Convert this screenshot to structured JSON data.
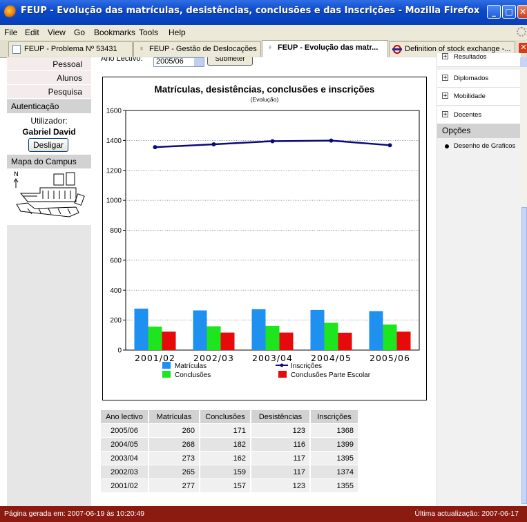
{
  "window": {
    "title": "FEUP - Evolução das matrículas, desistências, conclusões e das Inscrições - Mozilla Firefox"
  },
  "menu": {
    "file": "File",
    "edit": "Edit",
    "view": "View",
    "go": "Go",
    "bookmarks": "Bookmarks",
    "tools": "Tools",
    "help": "Help"
  },
  "tabs": [
    {
      "label": "FEUP - Problema Nº 53431",
      "icon": "page-icon"
    },
    {
      "label": "FEUP - Gestão de Deslocações",
      "icon": "feup-icon"
    },
    {
      "label": "FEUP - Evolução das matr...",
      "icon": "feup-icon"
    },
    {
      "label": "Definition of stock exchange -...",
      "icon": "tfl-roundel-icon"
    }
  ],
  "left_sidebar": {
    "nav": [
      "Pessoal",
      "Alunos",
      "Pesquisa"
    ],
    "auth_heading": "Autenticação",
    "user_label": "Utilizador:",
    "user_name": "Gabriel David",
    "logout": "Desligar",
    "map_heading": "Mapa do Campus",
    "map_north": "N"
  },
  "form": {
    "year_label": "Ano Lectivo:",
    "year_value": "2005/06",
    "submit": "Submeter"
  },
  "right_sidebar": {
    "items": [
      "Resultados",
      "Diplomados",
      "Mobilidade",
      "Docentes"
    ],
    "options_heading": "Opções",
    "charts_link": "Desenho de Graficos"
  },
  "chart_data": {
    "type": "bar",
    "title": "Matrículas, desistências, conclusões e inscrições",
    "subtitle": "(Evolução)",
    "categories": [
      "2001/02",
      "2002/03",
      "2003/04",
      "2004/05",
      "2005/06"
    ],
    "ylim": [
      0,
      1600
    ],
    "yticks": [
      0,
      200,
      400,
      600,
      800,
      1000,
      1200,
      1400,
      1600
    ],
    "grid": true,
    "series": [
      {
        "name": "Matrículas",
        "kind": "bar",
        "color": "#1e90f0",
        "values": [
          277,
          265,
          273,
          268,
          260
        ]
      },
      {
        "name": "Conclusões",
        "kind": "bar",
        "color": "#1ee61e",
        "values": [
          157,
          159,
          162,
          182,
          171
        ]
      },
      {
        "name": "Conclusões Parte Escolar",
        "kind": "bar",
        "color": "#e60a0a",
        "values": [
          123,
          117,
          117,
          116,
          123
        ]
      },
      {
        "name": "Inscrições",
        "kind": "line",
        "color": "#0a0a78",
        "values": [
          1355,
          1374,
          1395,
          1399,
          1368
        ]
      }
    ],
    "legend_position": "bottom"
  },
  "table": {
    "headers": [
      "Ano lectivo",
      "Matrículas",
      "Conclusões",
      "Desistências",
      "Inscrições"
    ],
    "rows": [
      [
        "2005/06",
        "260",
        "171",
        "123",
        "1368"
      ],
      [
        "2004/05",
        "268",
        "182",
        "116",
        "1399"
      ],
      [
        "2003/04",
        "273",
        "162",
        "117",
        "1395"
      ],
      [
        "2002/03",
        "265",
        "159",
        "117",
        "1374"
      ],
      [
        "2001/02",
        "277",
        "157",
        "123",
        "1355"
      ]
    ]
  },
  "status": {
    "generated": "Página gerada em: 2007-06-19 às 10:20:49",
    "updated": "Última actualização: 2007-06-17"
  }
}
